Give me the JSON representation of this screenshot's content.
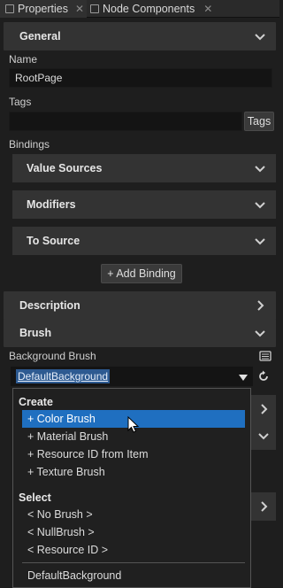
{
  "tabs": [
    {
      "label": "Properties"
    },
    {
      "label": "Node Components"
    }
  ],
  "general": {
    "header": "General",
    "name_label": "Name",
    "name_value": "RootPage",
    "tags_label": "Tags",
    "tags_value": "",
    "tags_button": "Tags",
    "bindings_label": "Bindings",
    "value_sources": "Value Sources",
    "modifiers": "Modifiers",
    "to_source": "To Source",
    "add_binding": "+ Add Binding"
  },
  "description": {
    "header": "Description"
  },
  "brush": {
    "header": "Brush",
    "background_label": "Background Brush",
    "background_value": "DefaultBackground"
  },
  "dropdown": {
    "create_label": "Create",
    "create_items": [
      "+ Color Brush",
      "+ Material Brush",
      "+ Resource ID from Item",
      "+ Texture Brush"
    ],
    "select_label": "Select",
    "select_items": [
      "< No Brush >",
      "< NullBrush >",
      "< Resource ID >"
    ],
    "resource_item": "DefaultBackground",
    "selected_index": 0
  },
  "colors": {
    "accent": "#1f6fc0",
    "panel": "#1e1e1e",
    "header": "#333333",
    "field": "#141414"
  },
  "icons": [
    "close-icon",
    "chevron-down-icon",
    "chevron-right-icon",
    "palette-icon",
    "reset-icon",
    "caret-down-icon",
    "mouse-cursor-icon"
  ]
}
